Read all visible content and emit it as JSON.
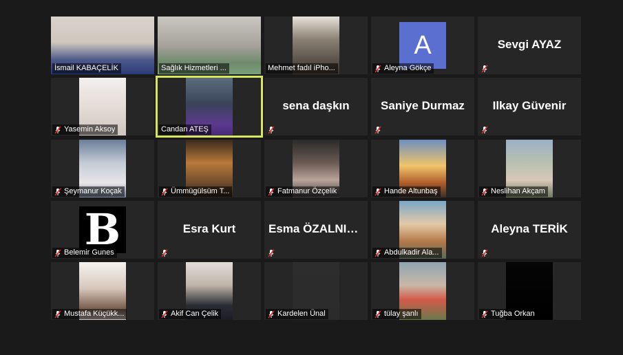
{
  "meeting": {
    "participants": [
      {
        "caption": "İsmail KABAÇELİK",
        "muted": false,
        "photo": "man-office",
        "wide": true
      },
      {
        "caption": "Sağlık Hizmetleri ...",
        "muted": false,
        "photo": "man-glasses",
        "wide": true
      },
      {
        "caption": "Mehmet fadıl iPho...",
        "muted": false,
        "photo": "man-bookshelf"
      },
      {
        "caption": "Aleyna Gökçe",
        "muted": true,
        "avatar_letter": "A",
        "avatar_color": "#5b6fd0"
      },
      {
        "caption": "",
        "muted": true,
        "display_name": "Sevgi AYAZ"
      },
      {
        "caption": "Yasemin Aksoy",
        "muted": true,
        "photo": "woman-white"
      },
      {
        "caption": "Candan ATEŞ",
        "muted": false,
        "photo": "man-purple",
        "active_speaker": true
      },
      {
        "caption": "",
        "muted": true,
        "display_name": "sena daşkın"
      },
      {
        "caption": "",
        "muted": true,
        "display_name": "Saniye Durmaz"
      },
      {
        "caption": "",
        "muted": true,
        "display_name": "Ilkay Güvenir"
      },
      {
        "caption": "Şeymanur Koçak",
        "muted": true,
        "photo": "woman-scarf"
      },
      {
        "caption": "Ümmügülsüm T...",
        "muted": true,
        "photo": "woman-lights"
      },
      {
        "caption": "Fatmanur Özçelik",
        "muted": true,
        "photo": "woman-dark"
      },
      {
        "caption": "Hande Altunbaş",
        "muted": true,
        "photo": "sunset"
      },
      {
        "caption": "Neslihan Akçam",
        "muted": true,
        "photo": "woman-landscape"
      },
      {
        "caption": "Belemir Gunes",
        "muted": true,
        "avatar_letter_serif": "B"
      },
      {
        "caption": "",
        "muted": true,
        "display_name": "Esra Kurt"
      },
      {
        "caption": "",
        "muted": true,
        "display_name": "Esma  ÖZALNIKI..."
      },
      {
        "caption": "Abdulkadir Ala...",
        "muted": true,
        "photo": "glasses-lake"
      },
      {
        "caption": "",
        "muted": true,
        "display_name": "Aleyna TERİK"
      },
      {
        "caption": "Mustafa Küçükk...",
        "muted": true,
        "photo": "man-beard"
      },
      {
        "caption": "Akif Can Çelik",
        "muted": true,
        "photo": "man-suit"
      },
      {
        "caption": "Kardelen Ünal",
        "muted": true,
        "photo": "dark-gray"
      },
      {
        "caption": "tülay şanlı",
        "muted": true,
        "photo": "toy-figures"
      },
      {
        "caption": "Tuğba Orkan",
        "muted": true,
        "photo": "black"
      }
    ]
  },
  "colors": {
    "background": "#1a1a1a",
    "tile": "#262626",
    "active_border": "#d8e85c",
    "mute_red": "#e02828"
  },
  "icons": {
    "mute": "microphone-muted-icon"
  }
}
